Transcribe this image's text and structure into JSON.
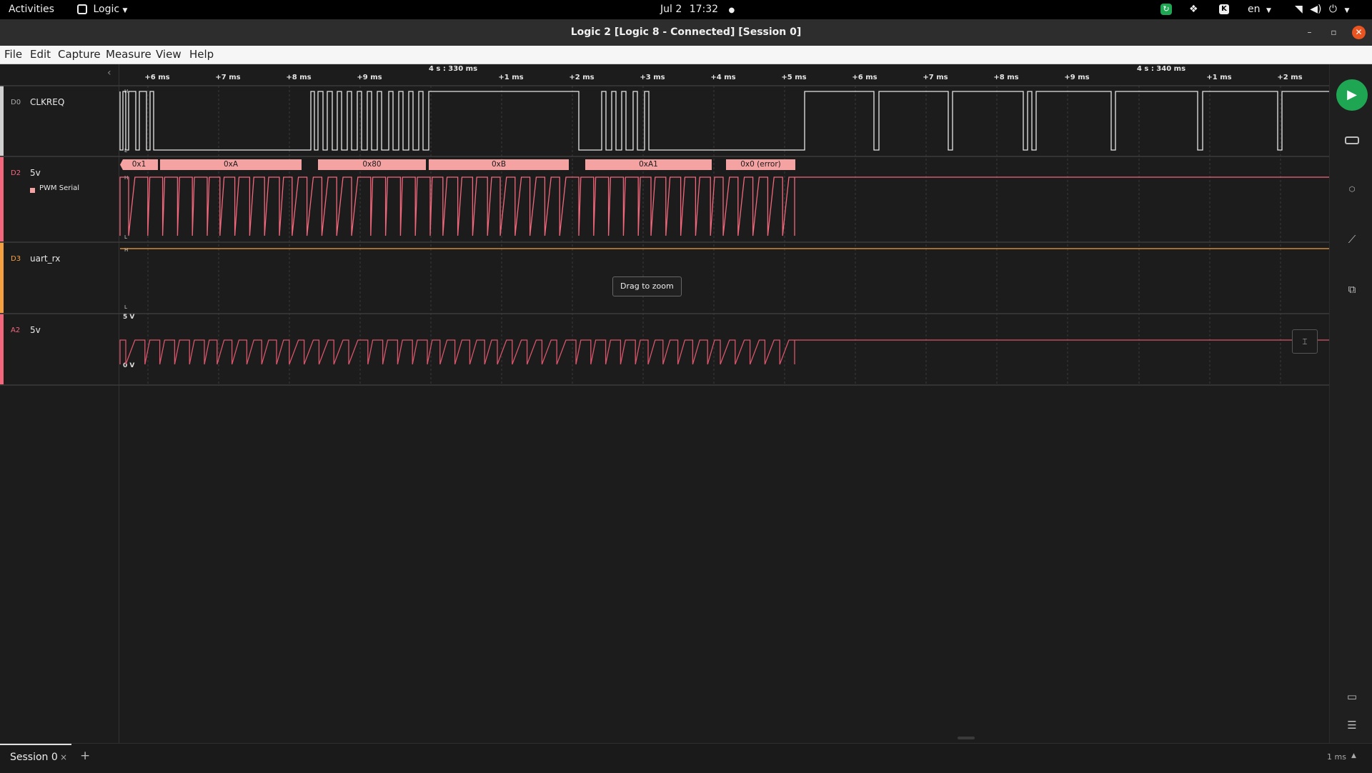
{
  "topbar": {
    "activities": "Activities",
    "app_name": "Logic",
    "date": "Jul 2",
    "time": "17:32",
    "language": "en",
    "app_icon": "logic-app-icon",
    "tray_icons": [
      "sync-icon",
      "dropbox-icon",
      "k-icon",
      "wifi-icon",
      "volume-icon",
      "power-icon"
    ]
  },
  "window": {
    "title": "Logic 2 [Logic 8 - Connected] [Session 0]"
  },
  "menu": [
    "File",
    "Edit",
    "Capture",
    "Measure",
    "View",
    "Help"
  ],
  "timeline": {
    "major_labels": [
      "4 s : 330 ms",
      "4 s : 340 ms"
    ],
    "tick_labels": [
      "+6 ms",
      "+7 ms",
      "+8 ms",
      "+9 ms",
      "+1 ms",
      "+2 ms",
      "+3 ms",
      "+4 ms",
      "+5 ms",
      "+6 ms",
      "+7 ms",
      "+8 ms",
      "+9 ms",
      "+1 ms",
      "+2 ms"
    ]
  },
  "channels": [
    {
      "id": "D0",
      "name": "CLKREQ",
      "color": "#e0e0e0"
    },
    {
      "id": "D2",
      "name": "5v",
      "color": "#f2677b",
      "analyzer": "PWM Serial"
    },
    {
      "id": "D3",
      "name": "uart_rx",
      "color": "#f5a142"
    },
    {
      "id": "A2",
      "name": "5v",
      "color": "#f2677b",
      "vmax": "5 V",
      "vmin": "0 V"
    }
  ],
  "decoded_bytes": [
    "0x1",
    "0xA",
    "0x80",
    "0xB",
    "0xA1",
    "0x0 (error)"
  ],
  "tooltip": "Drag to zoom",
  "right_icons": [
    "play-icon",
    "device-icon",
    "analyzer-icon",
    "measure-icon",
    "extensions-icon",
    "feedback-icon",
    "menu-icon"
  ],
  "bottom": {
    "session_tab": "Session 0",
    "close": "×",
    "add": "+",
    "zoom_scale": "1 ms"
  },
  "colors": {
    "accent_green": "#1ea653",
    "digital_white": "#e0e0e0",
    "pwm_pink": "#f2677b",
    "uart_orange": "#f5a142",
    "decode_bg": "#f4a2a2"
  }
}
